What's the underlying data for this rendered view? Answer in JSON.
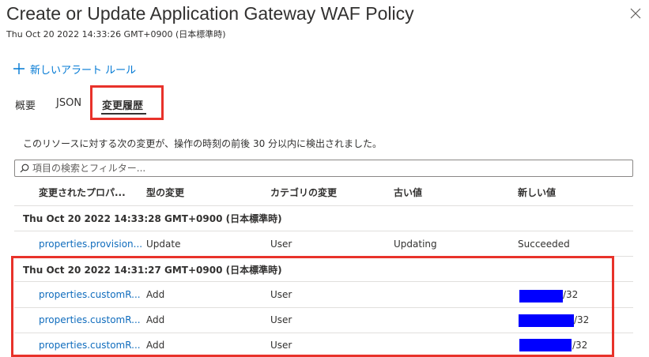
{
  "header": {
    "title": "Create or Update Application Gateway WAF Policy",
    "subtitle": "Thu Oct 20 2022 14:33:26 GMT+0900 (日本標準時)"
  },
  "toolbar": {
    "new_alert_rule_label": "新しいアラート ルール"
  },
  "tabs": [
    {
      "label": "概要"
    },
    {
      "label": "JSON"
    },
    {
      "label": "変更履歴",
      "active": true
    }
  ],
  "description": "このリソースに対する次の変更が、操作の時刻の前後 30 分以内に検出されました。",
  "search": {
    "placeholder": "項目の検索とフィルター..."
  },
  "table": {
    "columns": [
      "変更されたプロパ...",
      "型の変更",
      "カテゴリの変更",
      "古い値",
      "新しい値"
    ],
    "groups": [
      {
        "timestamp": "Thu Oct 20 2022 14:33:28 GMT+0900 (日本標準時)",
        "rows": [
          {
            "property": "properties.provision...",
            "type": "Update",
            "category": "User",
            "old_value": "Updating",
            "new_value": "Succeeded"
          }
        ]
      },
      {
        "timestamp": "Thu Oct 20 2022 14:31:27 GMT+0900 (日本標準時)",
        "rows": [
          {
            "property": "properties.customR...",
            "type": "Add",
            "category": "User",
            "old_value": "",
            "new_value_suffix": "/32"
          },
          {
            "property": "properties.customR...",
            "type": "Add",
            "category": "User",
            "old_value": "",
            "new_value_suffix": "/32"
          },
          {
            "property": "properties.customR...",
            "type": "Add",
            "category": "User",
            "old_value": "",
            "new_value_suffix": "/32"
          }
        ]
      }
    ]
  },
  "colors": {
    "accent": "#0078d4",
    "highlight": "#e8322a",
    "redaction": "#0000ff"
  }
}
